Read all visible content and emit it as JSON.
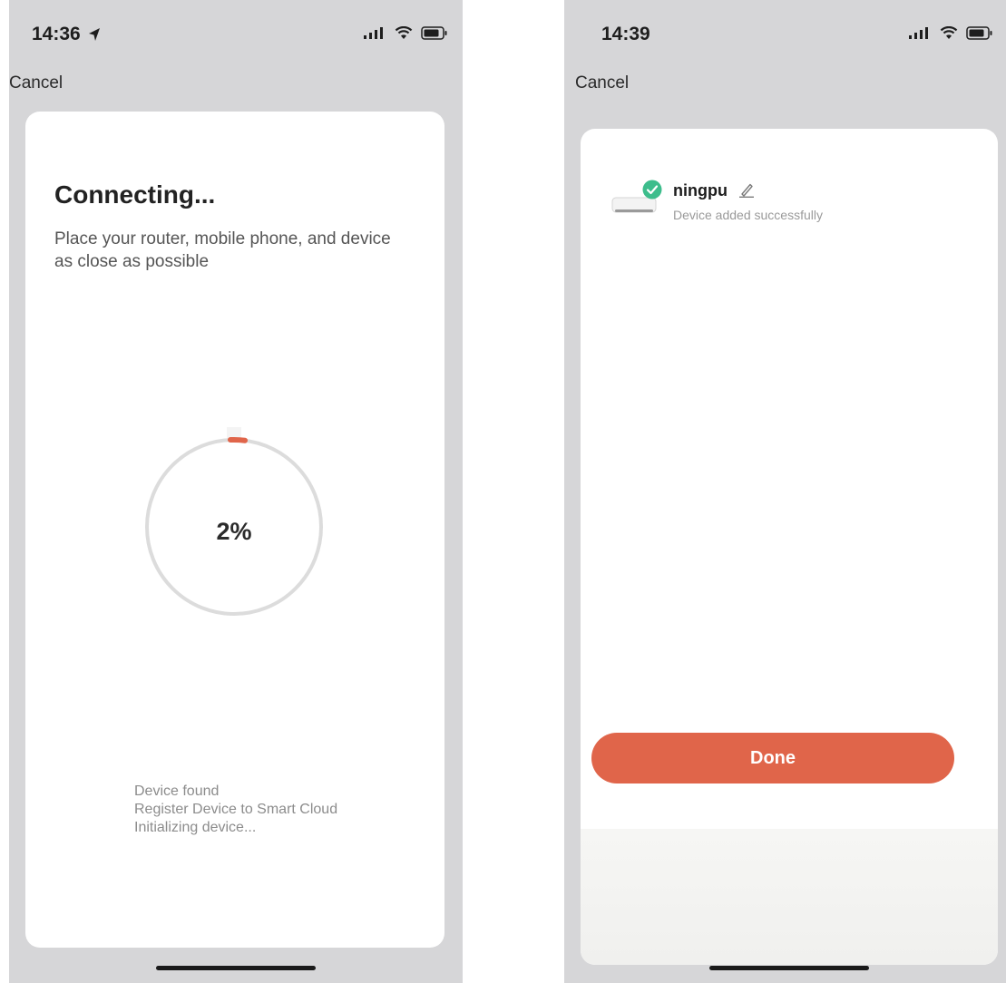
{
  "left_screen": {
    "status_bar": {
      "time": "14:36",
      "icons": [
        "location-arrow-icon",
        "signal-icon",
        "wifi-icon",
        "battery-icon"
      ]
    },
    "nav": {
      "cancel_label": "Cancel"
    },
    "heading": "Connecting...",
    "instruction": "Place your router, mobile phone, and device as close as possible",
    "progress": {
      "percent_label": "2%",
      "value": 2
    },
    "steps": [
      "Device found",
      "Register Device to Smart Cloud",
      "Initializing device..."
    ]
  },
  "right_screen": {
    "status_bar": {
      "time": "14:39",
      "icons": [
        "signal-icon",
        "wifi-icon",
        "battery-icon"
      ]
    },
    "nav": {
      "cancel_label": "Cancel"
    },
    "device": {
      "name": "ningpu",
      "status": "Device added successfully"
    },
    "done_label": "Done"
  },
  "colors": {
    "accent": "#e0654a",
    "success": "#3dbd8c",
    "screen_background": "#d6d6d8",
    "card_background": "#ffffff",
    "ring_track": "#dcdcdc"
  }
}
